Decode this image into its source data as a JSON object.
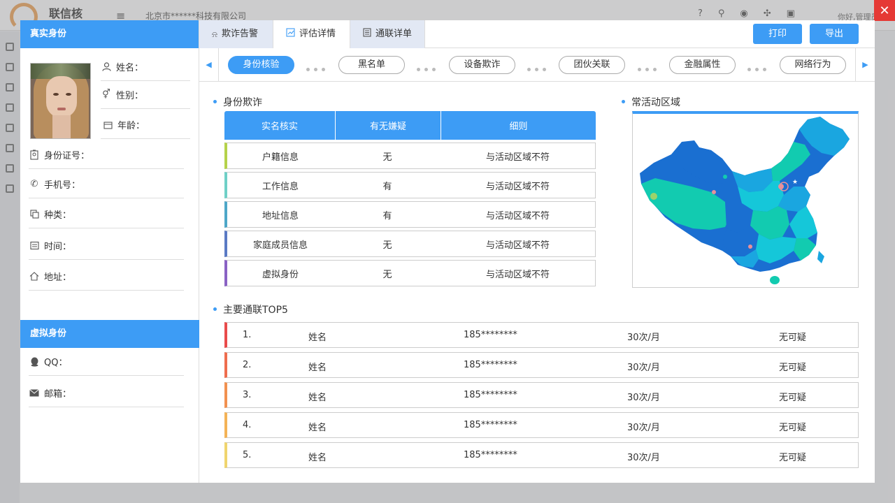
{
  "background": {
    "brand": "联信核",
    "company": "北京市******科技有限公司",
    "user_label": "你好,管理员"
  },
  "left": {
    "real_identity_header": "真实身份",
    "virtual_identity_header": "虚拟身份",
    "fields": {
      "name": "姓名：",
      "gender": "性别：",
      "age": "年龄：",
      "id_number": "身份证号：",
      "phone": "手机号：",
      "category": "种类：",
      "time": "时间：",
      "address": "地址："
    },
    "virtual_fields": {
      "qq": "QQ：",
      "email": "邮箱："
    }
  },
  "tabs": [
    {
      "label": "欺诈告警",
      "icon": "alarm-icon"
    },
    {
      "label": "评估详情",
      "icon": "chart-icon"
    },
    {
      "label": "通联详单",
      "icon": "list-icon"
    }
  ],
  "buttons": {
    "print": "打印",
    "export": "导出"
  },
  "steps": [
    "身份核验",
    "黑名单",
    "设备欺诈",
    "团伙关联",
    "金融属性",
    "网络行为"
  ],
  "identity_fraud": {
    "title": "身份欺诈",
    "headers": [
      "实名核实",
      "有无嫌疑",
      "细则"
    ],
    "rows": [
      {
        "name": "户籍信息",
        "suspect": "无",
        "detail": "与活动区域不符",
        "color": "#b5d24a"
      },
      {
        "name": "工作信息",
        "suspect": "有",
        "detail": "与活动区域不符",
        "color": "#6fd0c7"
      },
      {
        "name": "地址信息",
        "suspect": "有",
        "detail": "与活动区域不符",
        "color": "#4ea7c8"
      },
      {
        "name": "家庭成员信息",
        "suspect": "无",
        "detail": "与活动区域不符",
        "color": "#5a7ac4"
      },
      {
        "name": "虚拟身份",
        "suspect": "无",
        "detail": "与活动区域不符",
        "color": "#8a62c4"
      }
    ]
  },
  "active_area": {
    "title": "常活动区域"
  },
  "top5": {
    "title": "主要通联TOP5",
    "rows": [
      {
        "rank": "1.",
        "name": "姓名",
        "phone": "185********",
        "freq": "30次/月",
        "status": "无可疑",
        "color": "#e94b4b"
      },
      {
        "rank": "2.",
        "name": "姓名",
        "phone": "185********",
        "freq": "30次/月",
        "status": "无可疑",
        "color": "#ef6d4e"
      },
      {
        "rank": "3.",
        "name": "姓名",
        "phone": "185********",
        "freq": "30次/月",
        "status": "无可疑",
        "color": "#f29150"
      },
      {
        "rank": "4.",
        "name": "姓名",
        "phone": "185********",
        "freq": "30次/月",
        "status": "无可疑",
        "color": "#f4b356"
      },
      {
        "rank": "5.",
        "name": "姓名",
        "phone": "185********",
        "freq": "30次/月",
        "status": "无可疑",
        "color": "#f0d56e"
      }
    ]
  },
  "colors": {
    "accent": "#3d9cf5",
    "close": "#e53935",
    "map_dark": "#1a6fd1",
    "map_mid": "#1aa6e0",
    "map_teal": "#12cbb0",
    "map_cyan": "#15c7d9"
  }
}
